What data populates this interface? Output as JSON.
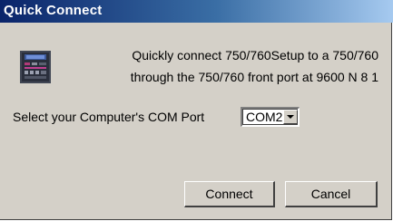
{
  "window": {
    "title": "Quick Connect"
  },
  "intro": {
    "line1": "Quickly connect 750/760Setup to a 750/760",
    "line2": "through the 750/760 front port at 9600 N 8 1"
  },
  "com_port": {
    "label": "Select your Computer's COM Port",
    "selected": "COM2"
  },
  "buttons": {
    "connect": "Connect",
    "cancel": "Cancel"
  },
  "icons": {
    "device": "relay-device-icon",
    "dropdown": "chevron-down-icon"
  },
  "colors": {
    "titlebar_start": "#0a246a",
    "titlebar_end": "#a6caf0",
    "dialog_background": "#d4d0c8"
  }
}
